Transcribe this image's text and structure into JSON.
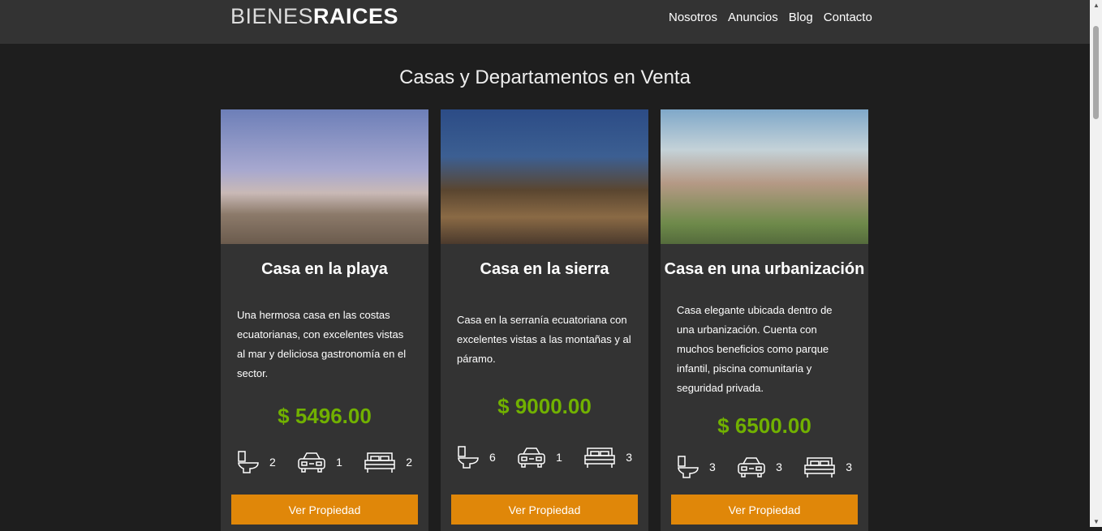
{
  "header": {
    "logo_light": "BIENES",
    "logo_bold": "RAICES",
    "nav": [
      "Nosotros",
      "Anuncios",
      "Blog",
      "Contacto"
    ]
  },
  "main": {
    "title": "Casas y Departamentos en Venta"
  },
  "cards": [
    {
      "title": "Casa en la playa",
      "description": "Una hermosa casa en las costas ecuatorianas, con excelentes vistas al mar y deliciosa gastronomía en el sector.",
      "price": "$ 5496.00",
      "bathrooms": "2",
      "parking": "1",
      "bedrooms": "2",
      "button": "Ver Propiedad"
    },
    {
      "title": "Casa en la sierra",
      "description": "Casa en la serranía ecuatoriana con excelentes vistas a las montañas y al páramo.",
      "price": "$ 9000.00",
      "bathrooms": "6",
      "parking": "1",
      "bedrooms": "3",
      "button": "Ver Propiedad"
    },
    {
      "title": "Casa en una urbanización",
      "description": "Casa elegante ubicada dentro de una urbanización. Cuenta con muchos beneficios como parque infantil, piscina comunitaria y seguridad privada.",
      "price": "$ 6500.00",
      "bathrooms": "3",
      "parking": "3",
      "bedrooms": "3",
      "button": "Ver Propiedad"
    }
  ],
  "colors": {
    "accent": "#e08709",
    "price": "#71b100",
    "header": "#333333",
    "background": "#1e1e1e"
  }
}
